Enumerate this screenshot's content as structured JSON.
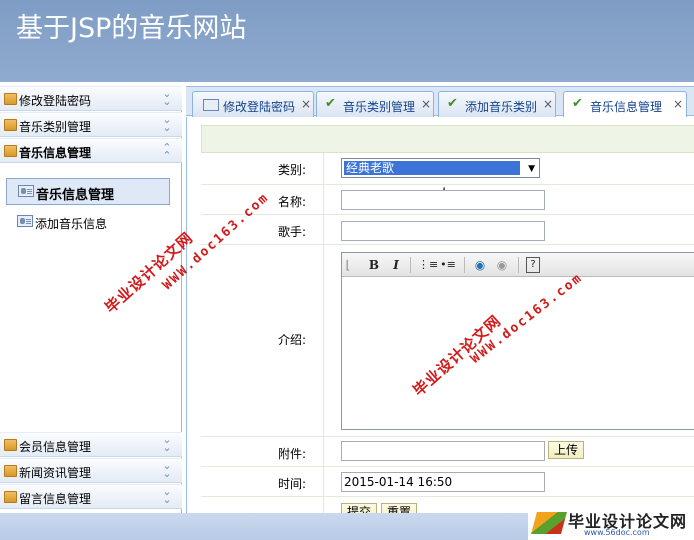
{
  "header": {
    "title": "基于JSP的音乐网站"
  },
  "sidebar": {
    "sections_top": [
      {
        "label": "修改登陆密码",
        "state": "collapsed"
      },
      {
        "label": "音乐类别管理",
        "state": "collapsed"
      },
      {
        "label": "音乐信息管理",
        "state": "expanded"
      }
    ],
    "items": [
      {
        "label": "音乐信息管理",
        "selected": true
      },
      {
        "label": "添加音乐信息",
        "selected": false
      }
    ],
    "sections_bottom": [
      {
        "label": "会员信息管理",
        "state": "collapsed"
      },
      {
        "label": "新闻资讯管理",
        "state": "collapsed"
      },
      {
        "label": "留言信息管理",
        "state": "collapsed"
      }
    ]
  },
  "tabs": [
    {
      "label": "修改登陆密码",
      "icon": "user-card-icon"
    },
    {
      "label": "音乐类别管理",
      "icon": "check-icon"
    },
    {
      "label": "添加音乐类别",
      "icon": "check-icon"
    },
    {
      "label": "音乐信息管理",
      "icon": "check-icon",
      "active": true
    }
  ],
  "tab_close": "×",
  "form": {
    "category": {
      "label": "类别:",
      "value": "经典老歌"
    },
    "name": {
      "label": "名称:",
      "value": ""
    },
    "singer": {
      "label": "歌手:",
      "value": ""
    },
    "intro": {
      "label": "介绍:"
    },
    "attachment": {
      "label": "附件:",
      "value": "",
      "upload_label": "上传"
    },
    "time": {
      "label": "时间:",
      "value": "2015-01-14 16:50"
    },
    "submit_label": "提交",
    "reset_label": "重置"
  },
  "editor_toolbar": {
    "bold": "B",
    "italic": "I",
    "help": "?"
  },
  "watermarks": {
    "brand": "毕业设计论文网",
    "url": "WWW.doc163.com"
  },
  "footer_logo": {
    "text": "毕业设计论文网",
    "url": "www.56doc.com"
  },
  "colors": {
    "header": "#8aa6cc",
    "accent": "#15428b",
    "selection": "#3b73d6",
    "watermark": "#d21a1a"
  }
}
